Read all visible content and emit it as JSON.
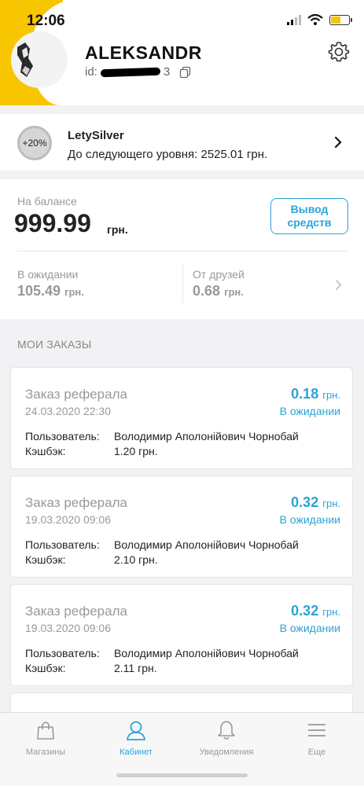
{
  "status_bar": {
    "time": "12:06"
  },
  "profile": {
    "name": "ALEKSANDR",
    "id_label": "id:",
    "id_suffix": "3"
  },
  "level": {
    "badge": "+20%",
    "name": "LetySilver",
    "next_level_text": "До следующего уровня: 2525.01 грн."
  },
  "balance": {
    "label": "На балансе",
    "amount": "999.99",
    "currency": "грн.",
    "withdraw_label": "Вывод средств",
    "pending_label": "В ожидании",
    "pending_value": "105.49",
    "pending_currency": "грн.",
    "friends_label": "От друзей",
    "friends_value": "0.68",
    "friends_currency": "грн."
  },
  "orders_title": "МОИ ЗАКАЗЫ",
  "orders": [
    {
      "title": "Заказ реферала",
      "date": "24.03.2020 22:30",
      "amount": "0.18",
      "currency": "грн.",
      "status": "В ожидании",
      "user_label": "Пользователь:",
      "user_value": "Володимир Аполонійович Чорнобай",
      "cashback_label": "Кэшбэк:",
      "cashback_value": "1.20 грн."
    },
    {
      "title": "Заказ реферала",
      "date": "19.03.2020 09:06",
      "amount": "0.32",
      "currency": "грн.",
      "status": "В ожидании",
      "user_label": "Пользователь:",
      "user_value": "Володимир Аполонійович Чорнобай",
      "cashback_label": "Кэшбэк:",
      "cashback_value": "2.10 грн."
    },
    {
      "title": "Заказ реферала",
      "date": "19.03.2020 09:06",
      "amount": "0.32",
      "currency": "грн.",
      "status": "В ожидании",
      "user_label": "Пользователь:",
      "user_value": "Володимир Аполонійович Чорнобай",
      "cashback_label": "Кэшбэк:",
      "cashback_value": "2.11 грн."
    }
  ],
  "tabs": [
    {
      "label": "Магазины",
      "icon": "bag-icon",
      "active": false
    },
    {
      "label": "Кабинет",
      "icon": "user-icon",
      "active": true
    },
    {
      "label": "Уведомления",
      "icon": "bell-icon",
      "active": false
    },
    {
      "label": "Еще",
      "icon": "menu-icon",
      "active": false
    }
  ],
  "colors": {
    "accent": "#2ba3d6",
    "brand_yellow": "#f7c600",
    "muted": "#999999"
  }
}
